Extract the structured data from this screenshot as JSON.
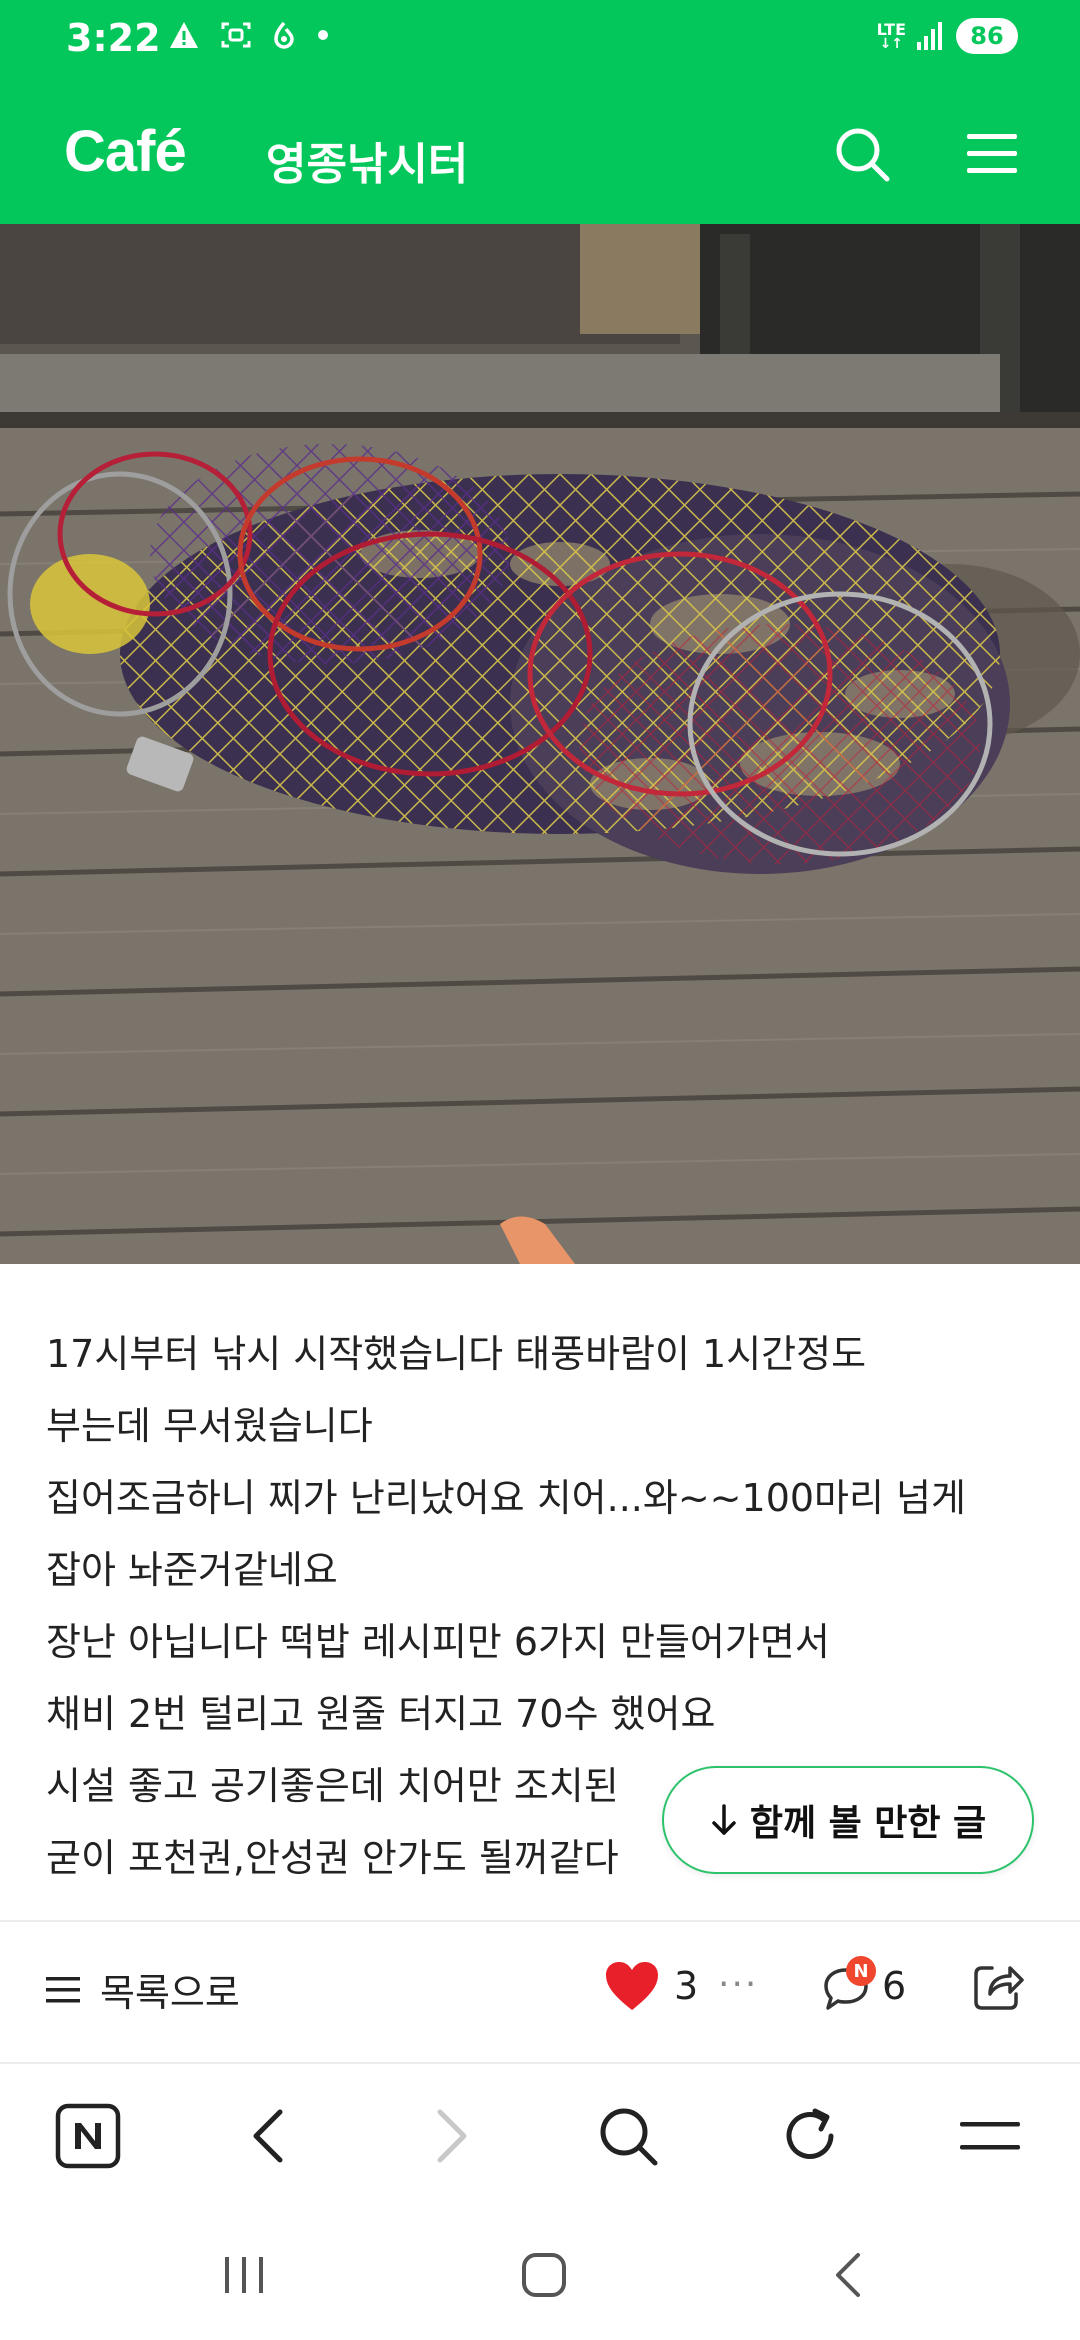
{
  "status_bar": {
    "time": "3:22",
    "network": "LTE",
    "battery": "86",
    "icons": [
      "warning-icon",
      "screen-record-icon",
      "notification-icon",
      "dot-icon",
      "signal-icon"
    ]
  },
  "header": {
    "logo": "Café",
    "cafe_name": "영종낚시터",
    "icons": [
      "search-icon",
      "menu-icon"
    ]
  },
  "post": {
    "lines": [
      "17시부터 낚시 시작했습니다 태풍바람이 1시간정도",
      "부는데 무서웠습니다",
      "집어조금하니 찌가 난리났어요 치어...와~~100마리 넘게",
      "잡아 놔준거같네요",
      "장난 아닙니다 떡밥 레시피만 6가지 만들어가면서",
      "채비 2번 털리고 원줄 터지고 70수 했어요",
      "시설 좋고 공기좋은데 치어만 조치된",
      "굳이 포천권,안성권 안가도 될꺼같다"
    ]
  },
  "related": {
    "label": "함께 볼 만한 글",
    "icon": "arrow-down-icon"
  },
  "actions": {
    "list_label": "목록으로",
    "like_count": "3",
    "comment_badge": "N",
    "comment_count": "6",
    "icons": [
      "list-icon",
      "heart-icon",
      "more-icon",
      "comment-icon",
      "share-icon"
    ]
  },
  "browser": {
    "icons": [
      "naver-n-icon",
      "back-icon",
      "forward-icon",
      "search-icon",
      "refresh-icon",
      "menu-icon"
    ]
  },
  "system_nav": {
    "icons": [
      "recent-apps-icon",
      "home-icon",
      "back-icon"
    ]
  },
  "colors": {
    "brand": "#03c75a",
    "like": "#e8202a",
    "badge": "#f0462d",
    "related_border": "#2ec26a"
  }
}
